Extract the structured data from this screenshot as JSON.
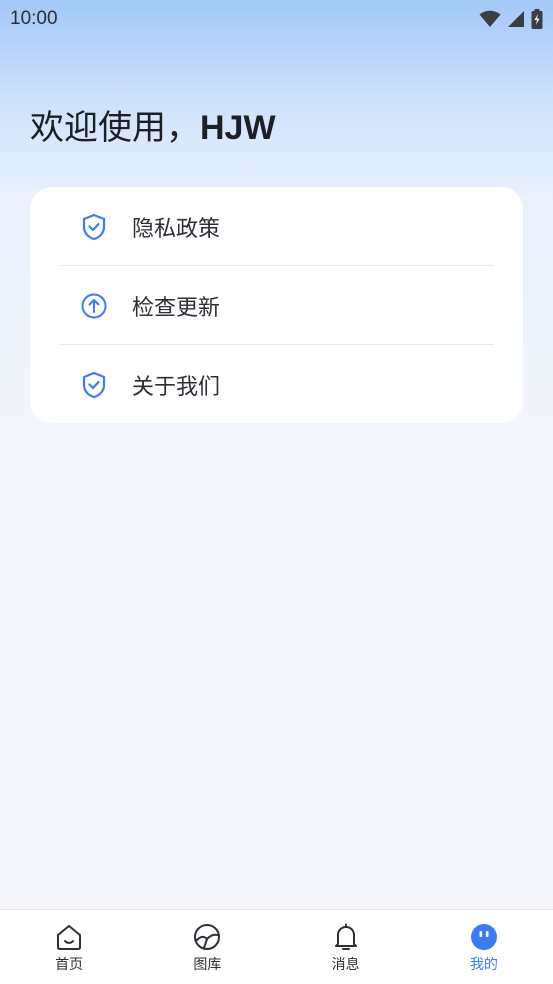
{
  "status_bar": {
    "time": "10:00"
  },
  "welcome": {
    "greeting": "欢迎使用，",
    "name": "HJW"
  },
  "menu": {
    "items": [
      {
        "label": "隐私政策",
        "icon": "shield-check-icon"
      },
      {
        "label": "检查更新",
        "icon": "arrow-up-circle-icon"
      },
      {
        "label": "关于我们",
        "icon": "shield-check-icon"
      }
    ]
  },
  "tabs": [
    {
      "label": "首页",
      "icon": "home-icon",
      "active": false
    },
    {
      "label": "图库",
      "icon": "gallery-icon",
      "active": false
    },
    {
      "label": "消息",
      "icon": "bell-icon",
      "active": false
    },
    {
      "label": "我的",
      "icon": "profile-icon",
      "active": true
    }
  ],
  "colors": {
    "accent": "#3b7cf0",
    "text": "#2b2f36",
    "background": "#f5f7fc"
  }
}
